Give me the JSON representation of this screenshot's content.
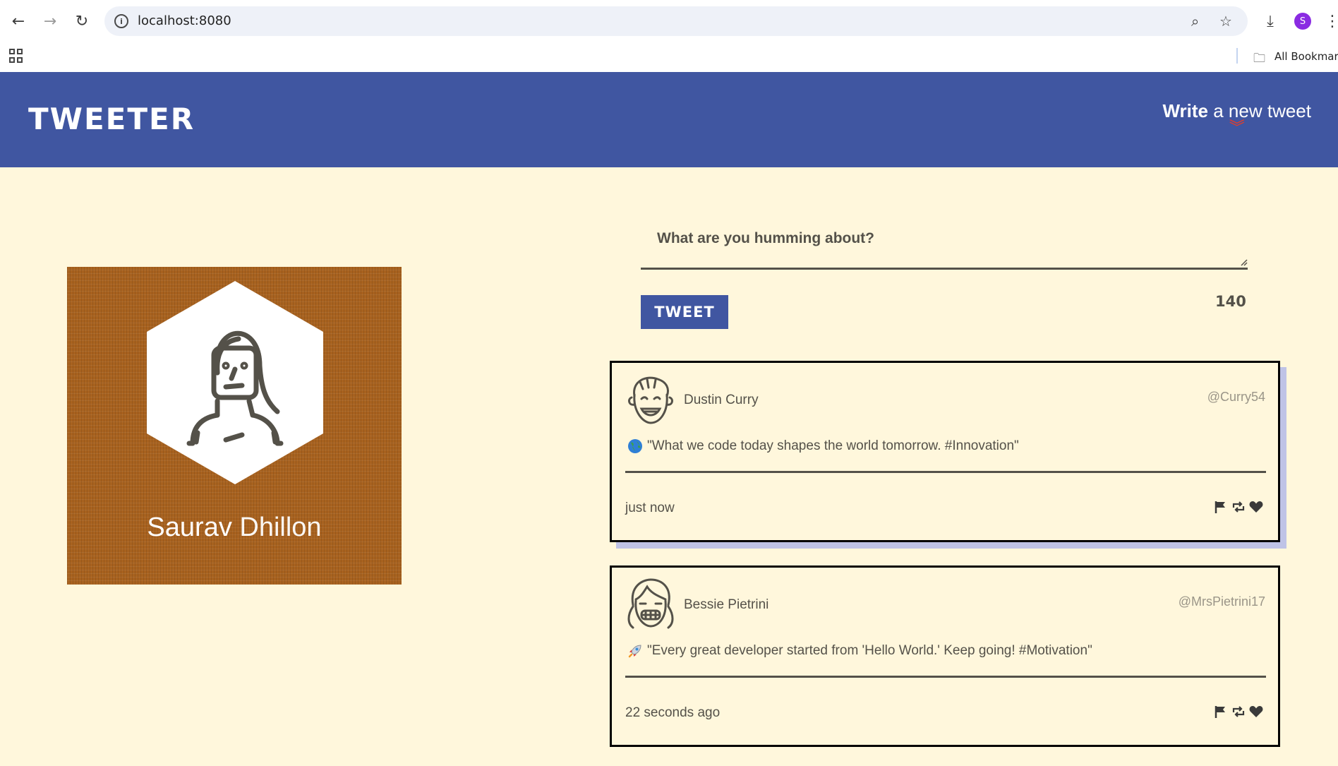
{
  "browser": {
    "url": "localhost:8080",
    "profile_initial": "S",
    "bookmarks_label": "All Bookmarks"
  },
  "header": {
    "logo": "TWEETER",
    "compose_bold": "Write",
    "compose_rest": " a new tweet",
    "accent": "#f13c20",
    "brand": "#4056a1"
  },
  "profile": {
    "first_name": "Saurav",
    "last_name": "Dhillon"
  },
  "composer": {
    "placeholder": "What are you humming about?",
    "button_label": "TWEET",
    "counter": "140"
  },
  "tweets": [
    {
      "name": "Dustin Curry",
      "handle": "@Curry54",
      "emoji_icon": "globe-icon",
      "content": "\"What we code today shapes the world tomorrow. #Innovation\"",
      "time": "just now"
    },
    {
      "name": "Bessie Pietrini",
      "handle": "@MrsPietrini17",
      "emoji_icon": "rocket-icon",
      "content": "\"Every great developer started from 'Hello World.' Keep going! #Motivation\"",
      "time": "22 seconds ago"
    }
  ]
}
